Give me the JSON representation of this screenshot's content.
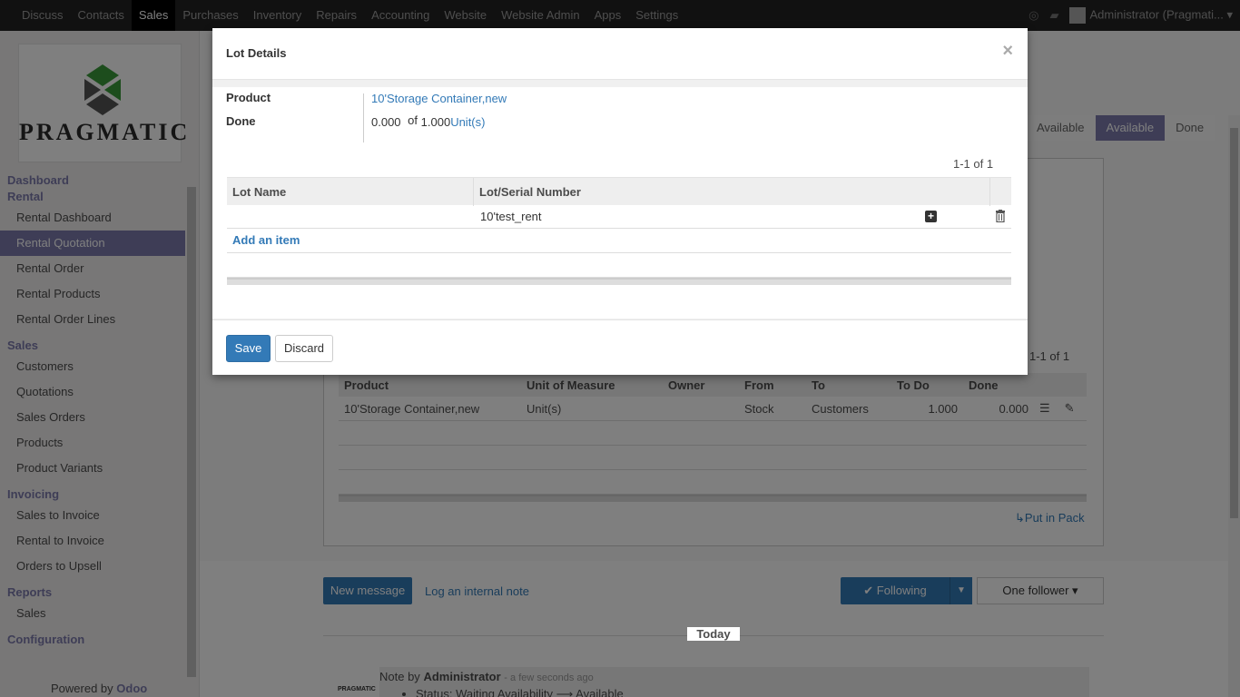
{
  "topbar": {
    "menu": [
      "Discuss",
      "Contacts",
      "Sales",
      "Purchases",
      "Inventory",
      "Repairs",
      "Accounting",
      "Website",
      "Website Admin",
      "Apps",
      "Settings"
    ],
    "active": "Sales",
    "user": "Administrator (Pragmati..."
  },
  "sidebar": {
    "logo_text": "PRAGMATIC",
    "sections": [
      {
        "title": "Dashboard",
        "items": []
      },
      {
        "title": "Rental",
        "items": [
          "Rental Dashboard",
          "Rental Quotation",
          "Rental Order",
          "Rental Products",
          "Rental Order Lines"
        ]
      },
      {
        "title": "Sales",
        "items": [
          "Customers",
          "Quotations",
          "Sales Orders",
          "Products",
          "Product Variants"
        ]
      },
      {
        "title": "Invoicing",
        "items": [
          "Sales to Invoice",
          "Rental to Invoice",
          "Orders to Upsell"
        ]
      },
      {
        "title": "Reports",
        "items": [
          "Sales"
        ]
      },
      {
        "title": "Configuration",
        "items": []
      }
    ],
    "active_item": "Rental Quotation",
    "powered_prefix": "Powered by",
    "powered_brand": "Odoo"
  },
  "background": {
    "stages": [
      "Available",
      "Available",
      "Done"
    ],
    "pager": "1-1 of 1",
    "table_headers": [
      "Product",
      "Unit of Measure",
      "Owner",
      "From",
      "To",
      "To Do",
      "Done"
    ],
    "row": {
      "product": "10'Storage Container,new",
      "uom": "Unit(s)",
      "owner": "",
      "from": "Stock",
      "to": "Customers",
      "todo": "1.000",
      "done": "0.000"
    },
    "put_in_pack": "↳Put in Pack",
    "chatter": {
      "new_message": "New message",
      "log_note": "Log an internal note",
      "following": "Following",
      "followers": "One follower",
      "today": "Today",
      "note_prefix": "Note by",
      "note_author": "Administrator",
      "note_time": "- a few seconds ago",
      "note_line": "Status: Waiting Availability ⟶ Available"
    }
  },
  "modal": {
    "title": "Lot Details",
    "product_label": "Product",
    "product_value": "10'Storage Container,new",
    "done_label": "Done",
    "done_value": "0.000",
    "of_text": "of",
    "total_value": "1.000",
    "uom": "Unit(s)",
    "pager": "1-1 of 1",
    "columns": [
      "Lot Name",
      "Lot/Serial Number"
    ],
    "rows": [
      {
        "lot_name": "",
        "serial": "10'test_rent"
      }
    ],
    "add_item": "Add an item",
    "save": "Save",
    "discard": "Discard"
  }
}
